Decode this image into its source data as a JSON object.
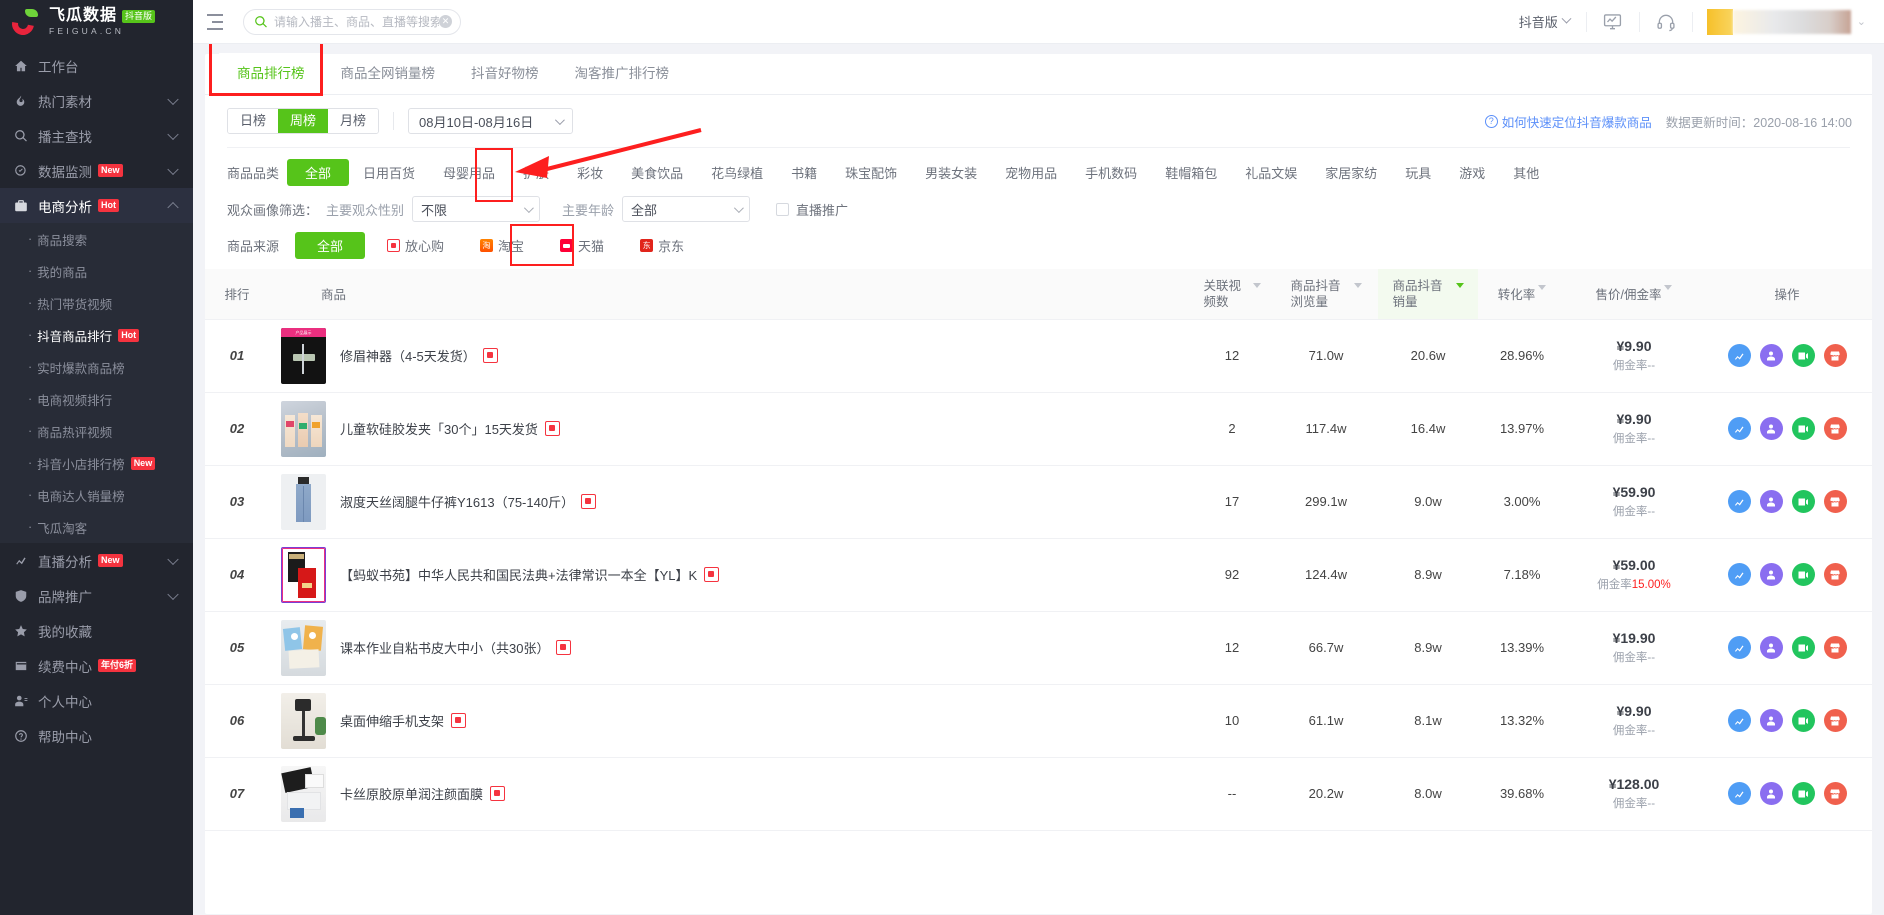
{
  "brand": {
    "name_cn": "飞瓜数据",
    "badge": "抖音版",
    "domain": "FEIGUA.CN"
  },
  "sidebar": {
    "items": [
      {
        "label": "工作台",
        "icon": "home-icon",
        "tag": "",
        "chevron": "",
        "active": false
      },
      {
        "label": "热门素材",
        "icon": "fire-icon",
        "tag": "",
        "chevron": "down",
        "active": false
      },
      {
        "label": "播主查找",
        "icon": "search-icon",
        "tag": "",
        "chevron": "down",
        "active": false
      },
      {
        "label": "数据监测",
        "icon": "monitor-icon",
        "tag": "New",
        "chevron": "down",
        "active": false
      },
      {
        "label": "电商分析",
        "icon": "briefcase-icon",
        "tag": "Hot",
        "chevron": "up",
        "active": true
      }
    ],
    "subitems": [
      {
        "label": "商品搜索",
        "tag": "",
        "active": false
      },
      {
        "label": "我的商品",
        "tag": "",
        "active": false
      },
      {
        "label": "热门带货视频",
        "tag": "",
        "active": false
      },
      {
        "label": "抖音商品排行",
        "tag": "Hot",
        "active": true
      },
      {
        "label": "实时爆款商品榜",
        "tag": "",
        "active": false
      },
      {
        "label": "电商视频排行",
        "tag": "",
        "active": false
      },
      {
        "label": "商品热评视频",
        "tag": "",
        "active": false
      },
      {
        "label": "抖音小店排行榜",
        "tag": "New",
        "active": false
      },
      {
        "label": "电商达人销量榜",
        "tag": "",
        "active": false
      },
      {
        "label": "飞瓜淘客",
        "tag": "",
        "active": false
      }
    ],
    "items_bottom": [
      {
        "label": "直播分析",
        "icon": "chart-line-icon",
        "tag": "New",
        "chevron": "down"
      },
      {
        "label": "品牌推广",
        "icon": "shield-icon",
        "tag": "",
        "chevron": "down"
      },
      {
        "label": "我的收藏",
        "icon": "star-icon",
        "tag": "",
        "chevron": ""
      },
      {
        "label": "续费中心",
        "icon": "card-icon",
        "tag": "年付6折",
        "chevron": ""
      },
      {
        "label": "个人中心",
        "icon": "user-icon",
        "tag": "",
        "chevron": ""
      },
      {
        "label": "帮助中心",
        "icon": "question-icon",
        "tag": "",
        "chevron": ""
      }
    ]
  },
  "topbar": {
    "collapse_icon": "collapse-menu-icon",
    "search_placeholder": "请输入播主、商品、直播等搜索",
    "search_value": "",
    "version_label": "抖音版",
    "monitor_icon": "screen-chart-icon",
    "support_icon": "headset-icon"
  },
  "tabs": [
    {
      "label": "商品排行榜",
      "active": true
    },
    {
      "label": "商品全网销量榜",
      "active": false
    },
    {
      "label": "抖音好物榜",
      "active": false
    },
    {
      "label": "淘客推广排行榜",
      "active": false
    }
  ],
  "toolbar": {
    "periods": [
      {
        "label": "日榜",
        "active": false
      },
      {
        "label": "周榜",
        "active": true
      },
      {
        "label": "月榜",
        "active": false
      }
    ],
    "date_range": "08月10日-08月16日",
    "help_link": "如何快速定位抖音爆款商品",
    "update_time": "数据更新时间：2020-08-16 14:00"
  },
  "filters": {
    "category_label": "商品品类",
    "categories": [
      {
        "label": "全部",
        "active": true
      },
      {
        "label": "日用百货",
        "active": false
      },
      {
        "label": "母婴用品",
        "active": false
      },
      {
        "label": "护肤",
        "active": false
      },
      {
        "label": "彩妆",
        "active": false
      },
      {
        "label": "美食饮品",
        "active": false
      },
      {
        "label": "花鸟绿植",
        "active": false
      },
      {
        "label": "书籍",
        "active": false
      },
      {
        "label": "珠宝配饰",
        "active": false
      },
      {
        "label": "男装女装",
        "active": false
      },
      {
        "label": "宠物用品",
        "active": false
      },
      {
        "label": "手机数码",
        "active": false
      },
      {
        "label": "鞋帽箱包",
        "active": false
      },
      {
        "label": "礼品文娱",
        "active": false
      },
      {
        "label": "家居家纺",
        "active": false
      },
      {
        "label": "玩具",
        "active": false
      },
      {
        "label": "游戏",
        "active": false
      },
      {
        "label": "其他",
        "active": false
      }
    ],
    "audience_label": "观众画像筛选：",
    "gender_label": "主要观众性别",
    "gender_value": "不限",
    "age_label": "主要年龄",
    "age_value": "全部",
    "live_promo_label": "直播推广",
    "live_promo_checked": false,
    "source_label": "商品来源",
    "sources": [
      {
        "label": "全部",
        "icon": "",
        "active": true
      },
      {
        "label": "放心购",
        "icon": "fangxingou-icon",
        "active": false
      },
      {
        "label": "淘宝",
        "icon": "taobao-icon",
        "active": false
      },
      {
        "label": "天猫",
        "icon": "tmall-icon",
        "active": false
      },
      {
        "label": "京东",
        "icon": "jd-icon",
        "active": false
      }
    ]
  },
  "table": {
    "columns": [
      {
        "key": "rank",
        "label": "排行",
        "sortable": false,
        "sorted": false
      },
      {
        "key": "product",
        "label": "商品",
        "sortable": false,
        "sorted": false
      },
      {
        "key": "videos",
        "label": "关联视频数",
        "sortable": true,
        "sorted": false
      },
      {
        "key": "views",
        "label": "商品抖音浏览量",
        "sortable": true,
        "sorted": false
      },
      {
        "key": "sales",
        "label": "商品抖音销量",
        "sortable": true,
        "sorted": true
      },
      {
        "key": "conversion",
        "label": "转化率",
        "sortable": true,
        "sorted": false
      },
      {
        "key": "price",
        "label": "售价/佣金率",
        "sortable": true,
        "sorted": false
      },
      {
        "key": "ops",
        "label": "操作",
        "sortable": false,
        "sorted": false
      }
    ],
    "rows": [
      {
        "rank": "01",
        "name": "修眉神器（4-5天发货）",
        "source_badge": "fangxingou-icon",
        "videos": "12",
        "views": "71.0w",
        "sales": "20.6w",
        "conversion": "28.96%",
        "price": "¥9.90",
        "commission": "佣金率--",
        "commission_value": ""
      },
      {
        "rank": "02",
        "name": "儿童软硅胶发夹「30个」15天发货",
        "source_badge": "fangxingou-icon",
        "videos": "2",
        "views": "117.4w",
        "sales": "16.4w",
        "conversion": "13.97%",
        "price": "¥9.90",
        "commission": "佣金率--",
        "commission_value": ""
      },
      {
        "rank": "03",
        "name": "淑度天丝阔腿牛仔裤Y1613（75-140斤）",
        "source_badge": "fangxingou-icon",
        "videos": "17",
        "views": "299.1w",
        "sales": "9.0w",
        "conversion": "3.00%",
        "price": "¥59.90",
        "commission": "佣金率--",
        "commission_value": ""
      },
      {
        "rank": "04",
        "name": "【蚂蚁书苑】中华人民共和国民法典+法律常识一本全【YL】K",
        "source_badge": "fangxingou-icon",
        "videos": "92",
        "views": "124.4w",
        "sales": "8.9w",
        "conversion": "7.18%",
        "price": "¥59.00",
        "commission": "佣金率",
        "commission_value": "15.00%"
      },
      {
        "rank": "05",
        "name": "课本作业自粘书皮大中小（共30张）",
        "source_badge": "fangxingou-icon",
        "videos": "12",
        "views": "66.7w",
        "sales": "8.9w",
        "conversion": "13.39%",
        "price": "¥19.90",
        "commission": "佣金率--",
        "commission_value": ""
      },
      {
        "rank": "06",
        "name": "桌面伸缩手机支架",
        "source_badge": "fangxingou-icon",
        "videos": "10",
        "views": "61.1w",
        "sales": "8.1w",
        "conversion": "13.32%",
        "price": "¥9.90",
        "commission": "佣金率--",
        "commission_value": ""
      },
      {
        "rank": "07",
        "name": "卡丝原胶原单润注颜面膜",
        "source_badge": "fangxingou-icon",
        "videos": "--",
        "views": "20.2w",
        "sales": "8.0w",
        "conversion": "39.68%",
        "price": "¥128.00",
        "commission": "佣金率--",
        "commission_value": ""
      }
    ],
    "op_buttons": [
      {
        "name": "trend-chart-icon",
        "color": "#4f9df5"
      },
      {
        "name": "influencer-icon",
        "color": "#8a6ef0"
      },
      {
        "name": "video-icon",
        "color": "#22c55e"
      },
      {
        "name": "shop-icon",
        "color": "#f0604d"
      }
    ]
  },
  "colors": {
    "accent_green": "#56c41a",
    "annotation_red": "#fd1f1f",
    "sidebar_bg": "#22252e",
    "link_blue": "#5b8ff9"
  }
}
